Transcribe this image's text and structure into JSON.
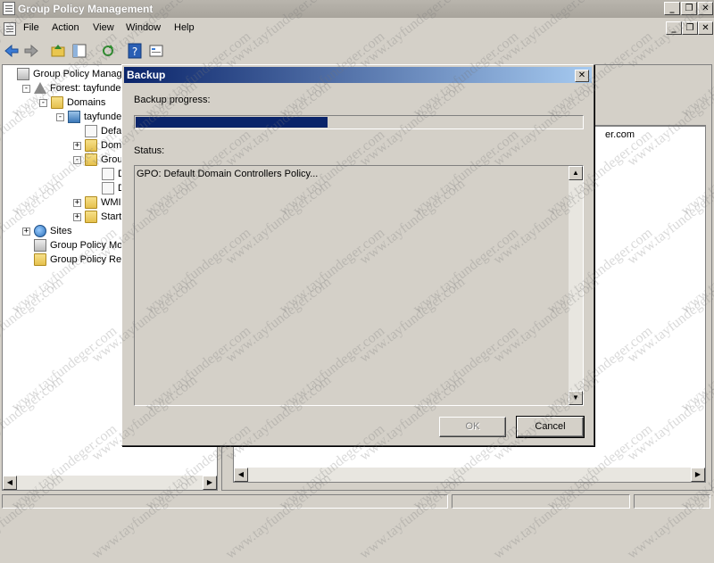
{
  "window": {
    "title": "Group Policy Management",
    "controls": [
      "min",
      "max",
      "close"
    ]
  },
  "menubar": {
    "items": [
      "File",
      "Action",
      "View",
      "Window",
      "Help"
    ]
  },
  "toolbar": {
    "icons": [
      "back-icon",
      "forward-icon",
      "up-folder-icon",
      "show-hide-tree-icon",
      "refresh-icon",
      "help-icon",
      "properties-icon"
    ]
  },
  "tree": {
    "items": [
      {
        "label": "Group Policy Manageme",
        "indent": 0,
        "icon": "gpm"
      },
      {
        "label": "Forest: tayfundege",
        "indent": 1,
        "icon": "forest",
        "expander": "-"
      },
      {
        "label": "Domains",
        "indent": 2,
        "icon": "folder",
        "expander": "-"
      },
      {
        "label": "tayfundege",
        "indent": 3,
        "icon": "domain",
        "expander": "-"
      },
      {
        "label": "Default",
        "indent": 4,
        "icon": "doc"
      },
      {
        "label": "Domain",
        "indent": 4,
        "icon": "folder",
        "expander": "+"
      },
      {
        "label": "Group P",
        "indent": 4,
        "icon": "folder",
        "expander": "-"
      },
      {
        "label": "De",
        "indent": 5,
        "icon": "doc"
      },
      {
        "label": "De",
        "indent": 5,
        "icon": "doc"
      },
      {
        "label": "WMI Fi",
        "indent": 4,
        "icon": "folder",
        "expander": "+"
      },
      {
        "label": "Starter",
        "indent": 4,
        "icon": "folder",
        "expander": "+"
      },
      {
        "label": "Sites",
        "indent": 1,
        "icon": "sites",
        "expander": "+"
      },
      {
        "label": "Group Policy Mo",
        "indent": 1,
        "icon": "gpm"
      },
      {
        "label": "Group Policy Re",
        "indent": 1,
        "icon": "folder"
      }
    ]
  },
  "right_pane": {
    "visible_text": "er.com"
  },
  "dialog": {
    "title": "Backup",
    "progress_label": "Backup progress:",
    "progress_fraction": 0.43,
    "status_label": "Status:",
    "status_text": "GPO: Default Domain Controllers Policy...",
    "ok_label": "OK",
    "cancel_label": "Cancel"
  },
  "watermark_text": "www.tayfundeger.com",
  "colors": {
    "dialog_title": "#0a246a",
    "progress": "#0a246a"
  }
}
